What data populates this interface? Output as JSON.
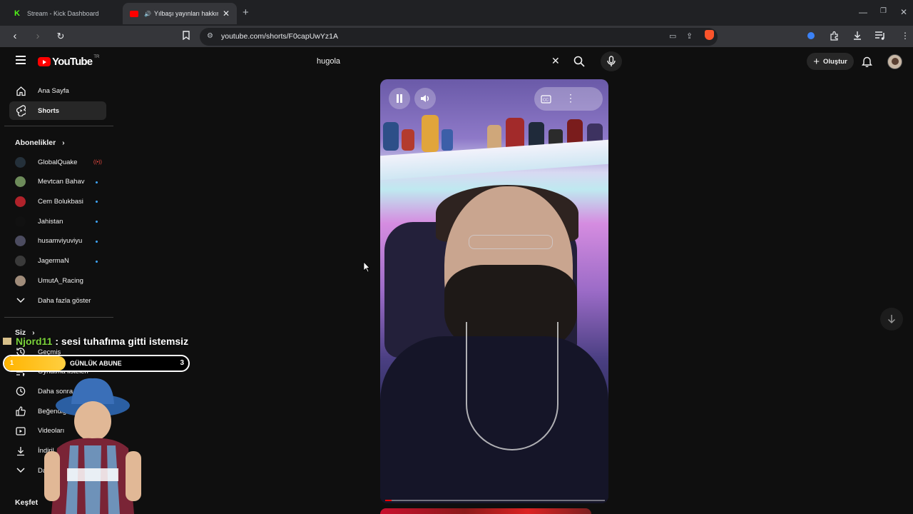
{
  "browser": {
    "tabs": [
      {
        "title": "Stream - Kick Dashboard",
        "icon": "kick-favicon"
      },
      {
        "title": "Yılbaşı yayınları hakkında | ",
        "icon": "youtube-favicon",
        "active": true
      }
    ],
    "url": "youtube.com/shorts/F0capUwYz1A"
  },
  "masthead": {
    "logo_text": "YouTube",
    "country_code": "TR",
    "search_value": "hugola",
    "create_label": "Oluştur"
  },
  "sidebar": {
    "main": [
      {
        "label": "Ana Sayfa",
        "icon": "home-icon"
      },
      {
        "label": "Shorts",
        "icon": "shorts-icon",
        "active": true
      }
    ],
    "subscriptions_title": "Abonelikler",
    "subscriptions": [
      {
        "label": "GlobalQuake",
        "avatar_color": "#24303a",
        "status": "live"
      },
      {
        "label": "Mevtcan Bahav",
        "avatar_color": "#6d8b5a",
        "status": "new"
      },
      {
        "label": "Cem Bolukbasi",
        "avatar_color": "#b0222a",
        "status": "new"
      },
      {
        "label": "Jahistan",
        "avatar_color": "#111111",
        "status": "new"
      },
      {
        "label": "husamviyuviyu",
        "avatar_color": "#4c4c60",
        "status": "new"
      },
      {
        "label": "JagermaN",
        "avatar_color": "#3a3a3a",
        "status": "new"
      },
      {
        "label": "UmutA_Racing",
        "avatar_color": "#a08c7a",
        "status": "none"
      }
    ],
    "show_more_label": "Daha fazla göster",
    "you_title": "Siz",
    "you_items": [
      {
        "label": "Geçmiş",
        "icon": "history-icon"
      },
      {
        "label": "Oynatma listeleri",
        "icon": "playlist-icon"
      },
      {
        "label": "Daha sonra iz",
        "icon": "clock-icon"
      },
      {
        "label": "Beğendiği",
        "icon": "thumbs-up-icon"
      },
      {
        "label": "Videoları",
        "icon": "video-icon"
      },
      {
        "label": "İndiril",
        "icon": "download-icon"
      },
      {
        "label": "Dal",
        "icon": "chevron-down-icon"
      }
    ],
    "explore_title": "Keşfet"
  },
  "player": {
    "progress": 0.03
  },
  "overlay": {
    "chat_user": "Njord11",
    "chat_message": ": sesi tuhafıma gitti istemsiz",
    "sub_goal_current": "1",
    "sub_goal_label": "GÜNLÜK ABUNE",
    "sub_goal_target": "3",
    "sub_goal_progress": 0.333
  },
  "colors": {
    "accent": "#ff0000",
    "background": "#0f0f0f",
    "chat_user": "#7bd23a",
    "sub_bar": "#ffb400"
  }
}
